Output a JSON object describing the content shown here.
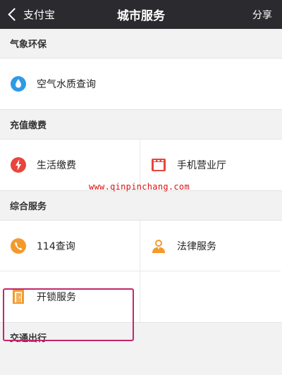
{
  "navbar": {
    "back_label": "支付宝",
    "title": "城市服务",
    "share_label": "分享"
  },
  "sections": [
    {
      "header": "气象环保",
      "items": [
        {
          "label": "空气水质查询",
          "icon": "water-drop-icon"
        }
      ]
    },
    {
      "header": "充值缴费",
      "items": [
        {
          "label": "生活缴费",
          "icon": "utility-bolt-icon"
        },
        {
          "label": "手机营业厅",
          "icon": "phone-store-icon"
        }
      ]
    },
    {
      "header": "综合服务",
      "items": [
        {
          "label": "114查询",
          "icon": "phone-call-icon"
        },
        {
          "label": "法律服务",
          "icon": "lawyer-icon"
        },
        {
          "label": "开锁服务",
          "icon": "door-lock-icon"
        }
      ]
    },
    {
      "header": "交通出行"
    }
  ],
  "watermark": "www.qinpinchang.com",
  "colors": {
    "navbar_bg": "#2b2b2f",
    "highlight": "#c3266b",
    "watermark": "#e01010"
  }
}
